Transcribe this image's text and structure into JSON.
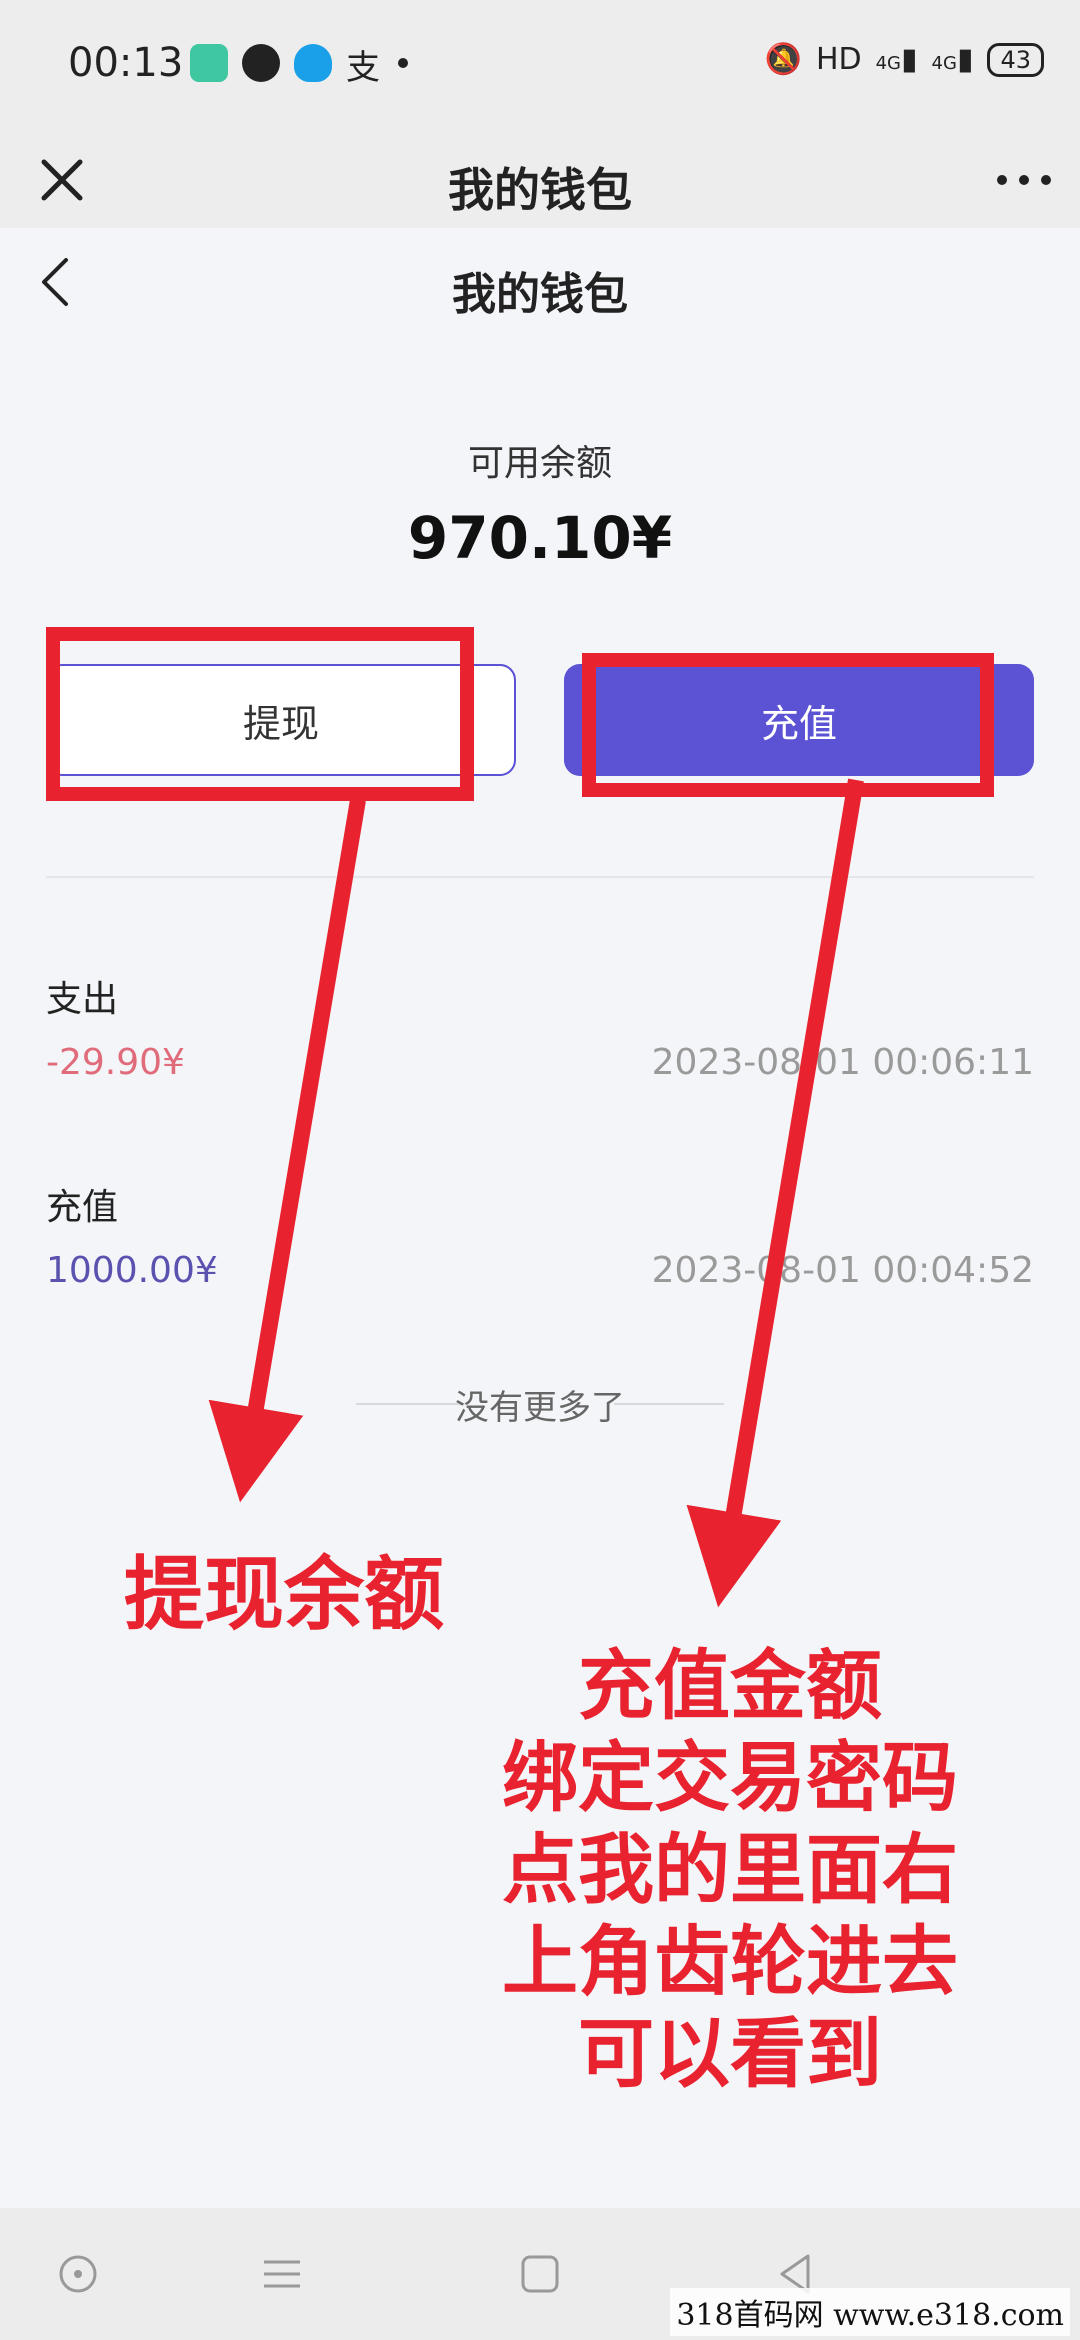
{
  "status_bar": {
    "time": "00:13",
    "network": "HD",
    "signal1": "4G",
    "signal2": "4G",
    "battery": "43"
  },
  "titlebar": {
    "title": "我的钱包"
  },
  "nav": {
    "title": "我的钱包"
  },
  "balance": {
    "label": "可用余额",
    "amount": "970.10¥"
  },
  "buttons": {
    "withdraw": "提现",
    "recharge": "充值"
  },
  "transactions": [
    {
      "type": "支出",
      "amount": "-29.90¥",
      "time": "2023-08-01 00:06:11",
      "color": "#e06b7a"
    },
    {
      "type": "充值",
      "amount": "1000.00¥",
      "time": "2023-08-01 00:04:52",
      "color": "#5b52b0"
    }
  ],
  "list_end": "没有更多了",
  "annotations": {
    "withdraw_note": "提现余额",
    "recharge_note": [
      "充值金额",
      "绑定交易密码",
      "点我的里面右",
      "上角齿轮进去",
      "可以看到"
    ]
  },
  "watermark": "318首码网 www.e318.com",
  "colors": {
    "accent": "#5b52d4",
    "annotation": "#e8232f"
  }
}
